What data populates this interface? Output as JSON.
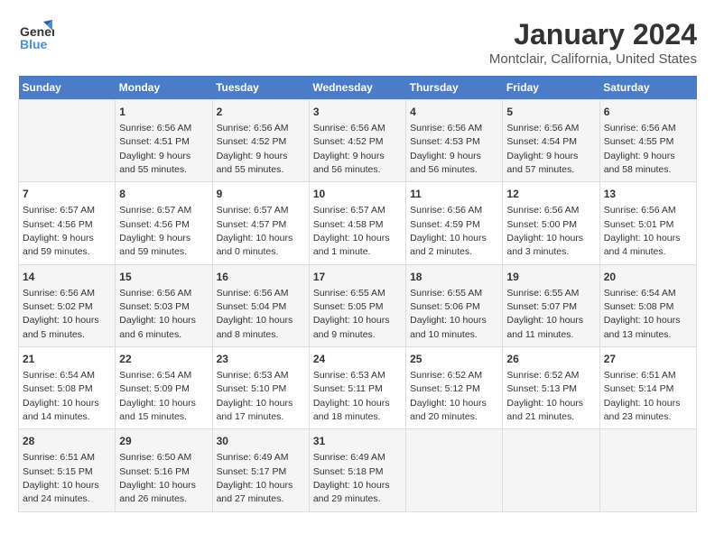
{
  "logo": {
    "text_general": "General",
    "text_blue": "Blue"
  },
  "title": "January 2024",
  "subtitle": "Montclair, California, United States",
  "weekdays": [
    "Sunday",
    "Monday",
    "Tuesday",
    "Wednesday",
    "Thursday",
    "Friday",
    "Saturday"
  ],
  "weeks": [
    [
      {
        "day": "",
        "sunrise": "",
        "sunset": "",
        "daylight": ""
      },
      {
        "day": "1",
        "sunrise": "Sunrise: 6:56 AM",
        "sunset": "Sunset: 4:51 PM",
        "daylight": "Daylight: 9 hours and 55 minutes."
      },
      {
        "day": "2",
        "sunrise": "Sunrise: 6:56 AM",
        "sunset": "Sunset: 4:52 PM",
        "daylight": "Daylight: 9 hours and 55 minutes."
      },
      {
        "day": "3",
        "sunrise": "Sunrise: 6:56 AM",
        "sunset": "Sunset: 4:52 PM",
        "daylight": "Daylight: 9 hours and 56 minutes."
      },
      {
        "day": "4",
        "sunrise": "Sunrise: 6:56 AM",
        "sunset": "Sunset: 4:53 PM",
        "daylight": "Daylight: 9 hours and 56 minutes."
      },
      {
        "day": "5",
        "sunrise": "Sunrise: 6:56 AM",
        "sunset": "Sunset: 4:54 PM",
        "daylight": "Daylight: 9 hours and 57 minutes."
      },
      {
        "day": "6",
        "sunrise": "Sunrise: 6:56 AM",
        "sunset": "Sunset: 4:55 PM",
        "daylight": "Daylight: 9 hours and 58 minutes."
      }
    ],
    [
      {
        "day": "7",
        "sunrise": "Sunrise: 6:57 AM",
        "sunset": "Sunset: 4:56 PM",
        "daylight": "Daylight: 9 hours and 59 minutes."
      },
      {
        "day": "8",
        "sunrise": "Sunrise: 6:57 AM",
        "sunset": "Sunset: 4:56 PM",
        "daylight": "Daylight: 9 hours and 59 minutes."
      },
      {
        "day": "9",
        "sunrise": "Sunrise: 6:57 AM",
        "sunset": "Sunset: 4:57 PM",
        "daylight": "Daylight: 10 hours and 0 minutes."
      },
      {
        "day": "10",
        "sunrise": "Sunrise: 6:57 AM",
        "sunset": "Sunset: 4:58 PM",
        "daylight": "Daylight: 10 hours and 1 minute."
      },
      {
        "day": "11",
        "sunrise": "Sunrise: 6:56 AM",
        "sunset": "Sunset: 4:59 PM",
        "daylight": "Daylight: 10 hours and 2 minutes."
      },
      {
        "day": "12",
        "sunrise": "Sunrise: 6:56 AM",
        "sunset": "Sunset: 5:00 PM",
        "daylight": "Daylight: 10 hours and 3 minutes."
      },
      {
        "day": "13",
        "sunrise": "Sunrise: 6:56 AM",
        "sunset": "Sunset: 5:01 PM",
        "daylight": "Daylight: 10 hours and 4 minutes."
      }
    ],
    [
      {
        "day": "14",
        "sunrise": "Sunrise: 6:56 AM",
        "sunset": "Sunset: 5:02 PM",
        "daylight": "Daylight: 10 hours and 5 minutes."
      },
      {
        "day": "15",
        "sunrise": "Sunrise: 6:56 AM",
        "sunset": "Sunset: 5:03 PM",
        "daylight": "Daylight: 10 hours and 6 minutes."
      },
      {
        "day": "16",
        "sunrise": "Sunrise: 6:56 AM",
        "sunset": "Sunset: 5:04 PM",
        "daylight": "Daylight: 10 hours and 8 minutes."
      },
      {
        "day": "17",
        "sunrise": "Sunrise: 6:55 AM",
        "sunset": "Sunset: 5:05 PM",
        "daylight": "Daylight: 10 hours and 9 minutes."
      },
      {
        "day": "18",
        "sunrise": "Sunrise: 6:55 AM",
        "sunset": "Sunset: 5:06 PM",
        "daylight": "Daylight: 10 hours and 10 minutes."
      },
      {
        "day": "19",
        "sunrise": "Sunrise: 6:55 AM",
        "sunset": "Sunset: 5:07 PM",
        "daylight": "Daylight: 10 hours and 11 minutes."
      },
      {
        "day": "20",
        "sunrise": "Sunrise: 6:54 AM",
        "sunset": "Sunset: 5:08 PM",
        "daylight": "Daylight: 10 hours and 13 minutes."
      }
    ],
    [
      {
        "day": "21",
        "sunrise": "Sunrise: 6:54 AM",
        "sunset": "Sunset: 5:08 PM",
        "daylight": "Daylight: 10 hours and 14 minutes."
      },
      {
        "day": "22",
        "sunrise": "Sunrise: 6:54 AM",
        "sunset": "Sunset: 5:09 PM",
        "daylight": "Daylight: 10 hours and 15 minutes."
      },
      {
        "day": "23",
        "sunrise": "Sunrise: 6:53 AM",
        "sunset": "Sunset: 5:10 PM",
        "daylight": "Daylight: 10 hours and 17 minutes."
      },
      {
        "day": "24",
        "sunrise": "Sunrise: 6:53 AM",
        "sunset": "Sunset: 5:11 PM",
        "daylight": "Daylight: 10 hours and 18 minutes."
      },
      {
        "day": "25",
        "sunrise": "Sunrise: 6:52 AM",
        "sunset": "Sunset: 5:12 PM",
        "daylight": "Daylight: 10 hours and 20 minutes."
      },
      {
        "day": "26",
        "sunrise": "Sunrise: 6:52 AM",
        "sunset": "Sunset: 5:13 PM",
        "daylight": "Daylight: 10 hours and 21 minutes."
      },
      {
        "day": "27",
        "sunrise": "Sunrise: 6:51 AM",
        "sunset": "Sunset: 5:14 PM",
        "daylight": "Daylight: 10 hours and 23 minutes."
      }
    ],
    [
      {
        "day": "28",
        "sunrise": "Sunrise: 6:51 AM",
        "sunset": "Sunset: 5:15 PM",
        "daylight": "Daylight: 10 hours and 24 minutes."
      },
      {
        "day": "29",
        "sunrise": "Sunrise: 6:50 AM",
        "sunset": "Sunset: 5:16 PM",
        "daylight": "Daylight: 10 hours and 26 minutes."
      },
      {
        "day": "30",
        "sunrise": "Sunrise: 6:49 AM",
        "sunset": "Sunset: 5:17 PM",
        "daylight": "Daylight: 10 hours and 27 minutes."
      },
      {
        "day": "31",
        "sunrise": "Sunrise: 6:49 AM",
        "sunset": "Sunset: 5:18 PM",
        "daylight": "Daylight: 10 hours and 29 minutes."
      },
      {
        "day": "",
        "sunrise": "",
        "sunset": "",
        "daylight": ""
      },
      {
        "day": "",
        "sunrise": "",
        "sunset": "",
        "daylight": ""
      },
      {
        "day": "",
        "sunrise": "",
        "sunset": "",
        "daylight": ""
      }
    ]
  ]
}
